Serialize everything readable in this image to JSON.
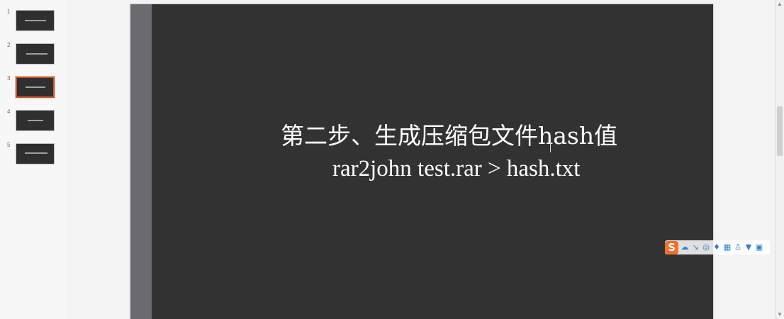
{
  "thumbnails": [
    {
      "number": "1",
      "selected": false
    },
    {
      "number": "2",
      "selected": false
    },
    {
      "number": "3",
      "selected": true
    },
    {
      "number": "4",
      "selected": false
    },
    {
      "number": "5",
      "selected": false
    }
  ],
  "slide": {
    "line1": "第二步、生成压缩包文件hash值",
    "line2": "rar2john test.rar > hash.txt"
  },
  "ime_toolbar": {
    "logo": "S",
    "icons": [
      "cloud-icon",
      "link-icon",
      "globe-icon",
      "mic-icon",
      "keyboard-icon",
      "user-icon",
      "shirt-icon",
      "tools-icon"
    ]
  },
  "colors": {
    "slide_background": "#323232",
    "slide_side_bar": "#6b6b6f",
    "selected_thumbnail_border": "#c9562c",
    "ime_accent": "#f0712a"
  }
}
